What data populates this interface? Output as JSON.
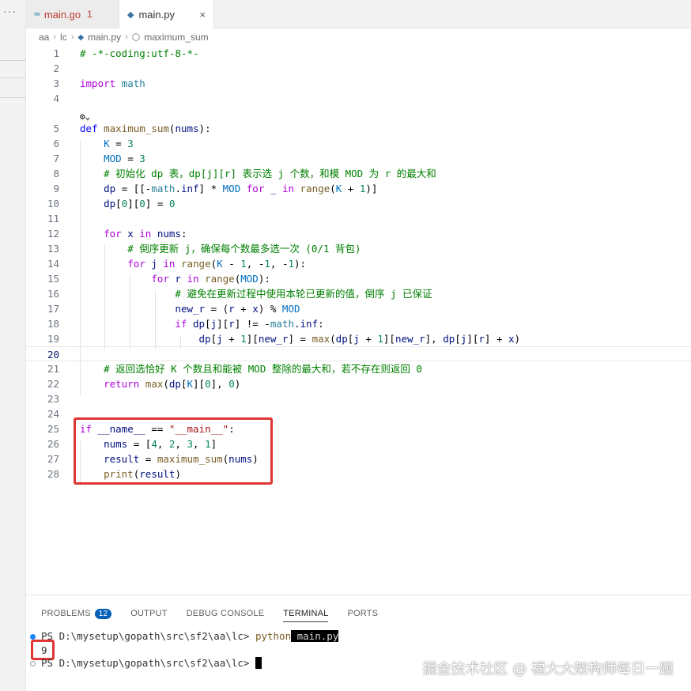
{
  "activity": {
    "more_label": "···"
  },
  "tabs": [
    {
      "label": "main.go",
      "badge": "1",
      "icon": "go-file-icon",
      "close": ""
    },
    {
      "label": "main.py",
      "badge": "",
      "icon": "python-file-icon",
      "close": "×"
    }
  ],
  "breadcrumb": [
    "aa",
    "lc",
    "main.py",
    "maximum_sum"
  ],
  "codelens": "⚙⌄",
  "code_lines": [
    {
      "n": "1",
      "spans": [
        [
          "cm",
          "# -*-coding:utf-8-*-"
        ]
      ]
    },
    {
      "n": "2",
      "spans": []
    },
    {
      "n": "3",
      "spans": [
        [
          "ctl",
          "import"
        ],
        [
          "",
          " "
        ],
        [
          "mod",
          "math"
        ]
      ]
    },
    {
      "n": "4",
      "spans": []
    },
    {
      "n": "5",
      "spans": [
        [
          "kw",
          "def"
        ],
        [
          "",
          " "
        ],
        [
          "fn",
          "maximum_sum"
        ],
        [
          "",
          "("
        ],
        [
          "vr",
          "nums"
        ],
        [
          "",
          "):"
        ]
      ]
    },
    {
      "n": "6",
      "spans": [
        [
          "",
          "    "
        ],
        [
          "cs",
          "K"
        ],
        [
          "",
          " = "
        ],
        [
          "nm",
          "3"
        ]
      ]
    },
    {
      "n": "7",
      "spans": [
        [
          "",
          "    "
        ],
        [
          "cs",
          "MOD"
        ],
        [
          "",
          " = "
        ],
        [
          "nm",
          "3"
        ]
      ]
    },
    {
      "n": "8",
      "spans": [
        [
          "",
          "    "
        ],
        [
          "cm",
          "# 初始化 dp 表，dp[j][r] 表示选 j 个数，和模 MOD 为 r 的最大和"
        ]
      ]
    },
    {
      "n": "9",
      "spans": [
        [
          "",
          "    "
        ],
        [
          "vr",
          "dp"
        ],
        [
          "",
          " = [[-"
        ],
        [
          "mod",
          "math"
        ],
        [
          "",
          "."
        ],
        [
          "vr",
          "inf"
        ],
        [
          "",
          "] * "
        ],
        [
          "cs",
          "MOD"
        ],
        [
          "",
          " "
        ],
        [
          "ctl",
          "for"
        ],
        [
          "",
          " "
        ],
        [
          "vr",
          "_"
        ],
        [
          "",
          " "
        ],
        [
          "ctl",
          "in"
        ],
        [
          "",
          " "
        ],
        [
          "fn",
          "range"
        ],
        [
          "",
          "("
        ],
        [
          "cs",
          "K"
        ],
        [
          "",
          " + "
        ],
        [
          "nm",
          "1"
        ],
        [
          "",
          ")]"
        ]
      ]
    },
    {
      "n": "10",
      "spans": [
        [
          "",
          "    "
        ],
        [
          "vr",
          "dp"
        ],
        [
          "",
          "["
        ],
        [
          "nm",
          "0"
        ],
        [
          "",
          "]["
        ],
        [
          "nm",
          "0"
        ],
        [
          "",
          "] = "
        ],
        [
          "nm",
          "0"
        ]
      ]
    },
    {
      "n": "11",
      "spans": []
    },
    {
      "n": "12",
      "spans": [
        [
          "",
          "    "
        ],
        [
          "ctl",
          "for"
        ],
        [
          "",
          " "
        ],
        [
          "vr",
          "x"
        ],
        [
          "",
          " "
        ],
        [
          "ctl",
          "in"
        ],
        [
          "",
          " "
        ],
        [
          "vr",
          "nums"
        ],
        [
          "",
          ":"
        ]
      ]
    },
    {
      "n": "13",
      "spans": [
        [
          "",
          "        "
        ],
        [
          "cm",
          "# 倒序更新 j，确保每个数最多选一次 (0/1 背包)"
        ]
      ]
    },
    {
      "n": "14",
      "spans": [
        [
          "",
          "        "
        ],
        [
          "ctl",
          "for"
        ],
        [
          "",
          " "
        ],
        [
          "vr",
          "j"
        ],
        [
          "",
          " "
        ],
        [
          "ctl",
          "in"
        ],
        [
          "",
          " "
        ],
        [
          "fn",
          "range"
        ],
        [
          "",
          "("
        ],
        [
          "cs",
          "K"
        ],
        [
          "",
          " - "
        ],
        [
          "nm",
          "1"
        ],
        [
          "",
          ", -"
        ],
        [
          "nm",
          "1"
        ],
        [
          "",
          ", -"
        ],
        [
          "nm",
          "1"
        ],
        [
          "",
          "):"
        ]
      ]
    },
    {
      "n": "15",
      "spans": [
        [
          "",
          "            "
        ],
        [
          "ctl",
          "for"
        ],
        [
          "",
          " "
        ],
        [
          "vr",
          "r"
        ],
        [
          "",
          " "
        ],
        [
          "ctl",
          "in"
        ],
        [
          "",
          " "
        ],
        [
          "fn",
          "range"
        ],
        [
          "",
          "("
        ],
        [
          "cs",
          "MOD"
        ],
        [
          "",
          "):"
        ]
      ]
    },
    {
      "n": "16",
      "spans": [
        [
          "",
          "                "
        ],
        [
          "cm",
          "# 避免在更新过程中使用本轮已更新的值，倒序 j 已保证"
        ]
      ]
    },
    {
      "n": "17",
      "spans": [
        [
          "",
          "                "
        ],
        [
          "vr",
          "new_r"
        ],
        [
          "",
          " = ("
        ],
        [
          "vr",
          "r"
        ],
        [
          "",
          " + "
        ],
        [
          "vr",
          "x"
        ],
        [
          "",
          ") % "
        ],
        [
          "cs",
          "MOD"
        ]
      ]
    },
    {
      "n": "18",
      "spans": [
        [
          "",
          "                "
        ],
        [
          "ctl",
          "if"
        ],
        [
          "",
          " "
        ],
        [
          "vr",
          "dp"
        ],
        [
          "",
          "["
        ],
        [
          "vr",
          "j"
        ],
        [
          "",
          "]["
        ],
        [
          "vr",
          "r"
        ],
        [
          "",
          "] != -"
        ],
        [
          "mod",
          "math"
        ],
        [
          "",
          "."
        ],
        [
          "vr",
          "inf"
        ],
        [
          "",
          ":"
        ]
      ]
    },
    {
      "n": "19",
      "spans": [
        [
          "",
          "                    "
        ],
        [
          "vr",
          "dp"
        ],
        [
          "",
          "["
        ],
        [
          "vr",
          "j"
        ],
        [
          "",
          " + "
        ],
        [
          "nm",
          "1"
        ],
        [
          "",
          "]["
        ],
        [
          "vr",
          "new_r"
        ],
        [
          "",
          "] = "
        ],
        [
          "fn",
          "max"
        ],
        [
          "",
          "("
        ],
        [
          "vr",
          "dp"
        ],
        [
          "",
          "["
        ],
        [
          "vr",
          "j"
        ],
        [
          "",
          " + "
        ],
        [
          "nm",
          "1"
        ],
        [
          "",
          "]["
        ],
        [
          "vr",
          "new_r"
        ],
        [
          "",
          "], "
        ],
        [
          "vr",
          "dp"
        ],
        [
          "",
          "["
        ],
        [
          "vr",
          "j"
        ],
        [
          "",
          "]["
        ],
        [
          "vr",
          "r"
        ],
        [
          "",
          "] + "
        ],
        [
          "vr",
          "x"
        ],
        [
          "",
          ")"
        ]
      ]
    },
    {
      "n": "20",
      "spans": []
    },
    {
      "n": "21",
      "spans": [
        [
          "",
          "    "
        ],
        [
          "cm",
          "# 返回选恰好 K 个数且和能被 MOD 整除的最大和，若不存在则返回 0"
        ]
      ]
    },
    {
      "n": "22",
      "spans": [
        [
          "",
          "    "
        ],
        [
          "ctl",
          "return"
        ],
        [
          "",
          " "
        ],
        [
          "fn",
          "max"
        ],
        [
          "",
          "("
        ],
        [
          "vr",
          "dp"
        ],
        [
          "",
          "["
        ],
        [
          "cs",
          "K"
        ],
        [
          "",
          "]["
        ],
        [
          "nm",
          "0"
        ],
        [
          "",
          "], "
        ],
        [
          "nm",
          "0"
        ],
        [
          "",
          ")"
        ]
      ]
    },
    {
      "n": "23",
      "spans": []
    },
    {
      "n": "24",
      "spans": []
    },
    {
      "n": "25",
      "spans": [
        [
          "ctl",
          "if"
        ],
        [
          "",
          " "
        ],
        [
          "vr",
          "__name__"
        ],
        [
          "",
          " == "
        ],
        [
          "st",
          "\"__main__\""
        ],
        [
          "",
          ":"
        ]
      ]
    },
    {
      "n": "26",
      "spans": [
        [
          "",
          "    "
        ],
        [
          "vr",
          "nums"
        ],
        [
          "",
          " = ["
        ],
        [
          "nm",
          "4"
        ],
        [
          "",
          ", "
        ],
        [
          "nm",
          "2"
        ],
        [
          "",
          ", "
        ],
        [
          "nm",
          "3"
        ],
        [
          "",
          ", "
        ],
        [
          "nm",
          "1"
        ],
        [
          "",
          "]"
        ]
      ]
    },
    {
      "n": "27",
      "spans": [
        [
          "",
          "    "
        ],
        [
          "vr",
          "result"
        ],
        [
          "",
          " = "
        ],
        [
          "fn",
          "maximum_sum"
        ],
        [
          "",
          "("
        ],
        [
          "vr",
          "nums"
        ],
        [
          "",
          ")"
        ]
      ]
    },
    {
      "n": "28",
      "spans": [
        [
          "",
          "    "
        ],
        [
          "fn",
          "print"
        ],
        [
          "",
          "("
        ],
        [
          "vr",
          "result"
        ],
        [
          "",
          ")"
        ]
      ]
    }
  ],
  "panel": {
    "tabs": [
      {
        "label": "PROBLEMS",
        "badge": "12",
        "active": false
      },
      {
        "label": "OUTPUT",
        "badge": "",
        "active": false
      },
      {
        "label": "DEBUG CONSOLE",
        "badge": "",
        "active": false
      },
      {
        "label": "TERMINAL",
        "badge": "",
        "active": true
      },
      {
        "label": "PORTS",
        "badge": "",
        "active": false
      }
    ]
  },
  "terminal": {
    "prompt1": "PS D:\\mysetup\\gopath\\src\\sf2\\aa\\lc> ",
    "cmd": "python",
    "arg": " main.py",
    "output": "9",
    "prompt2": "PS D:\\mysetup\\gopath\\src\\sf2\\aa\\lc> "
  },
  "watermark": "掘金技术社区 @ 福大大架构师每日一题",
  "colors": {
    "highlight_box": "#e03535",
    "keyword": "#0000ff",
    "control": "#af00db",
    "comment": "#008000"
  }
}
